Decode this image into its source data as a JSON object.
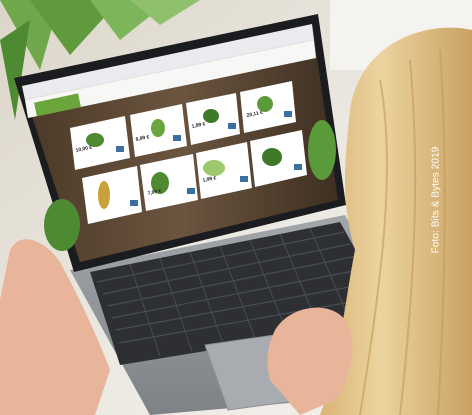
{
  "photo": {
    "subject": "woman using laptop to browse online grocery shop",
    "colors": {
      "background": "#ece9e3",
      "laptop_body": "#8f9397",
      "keyboard": "#2d2f33",
      "screen_bezel": "#1b1c1f",
      "hair": "#e5c690",
      "skin": "#e8b59a",
      "plant": "#5f9a3c"
    }
  },
  "shop_site": {
    "logo_text": "",
    "product_tiles": [
      {
        "price": "10,00 €"
      },
      {
        "price": "8,99 €"
      },
      {
        "price": "1,99 €"
      },
      {
        "price": "20,11 €"
      },
      {
        "price": "7,99 €"
      },
      {
        "price": "1,99 €"
      }
    ]
  },
  "credit": "Foto: Bits & Bytes 2019"
}
